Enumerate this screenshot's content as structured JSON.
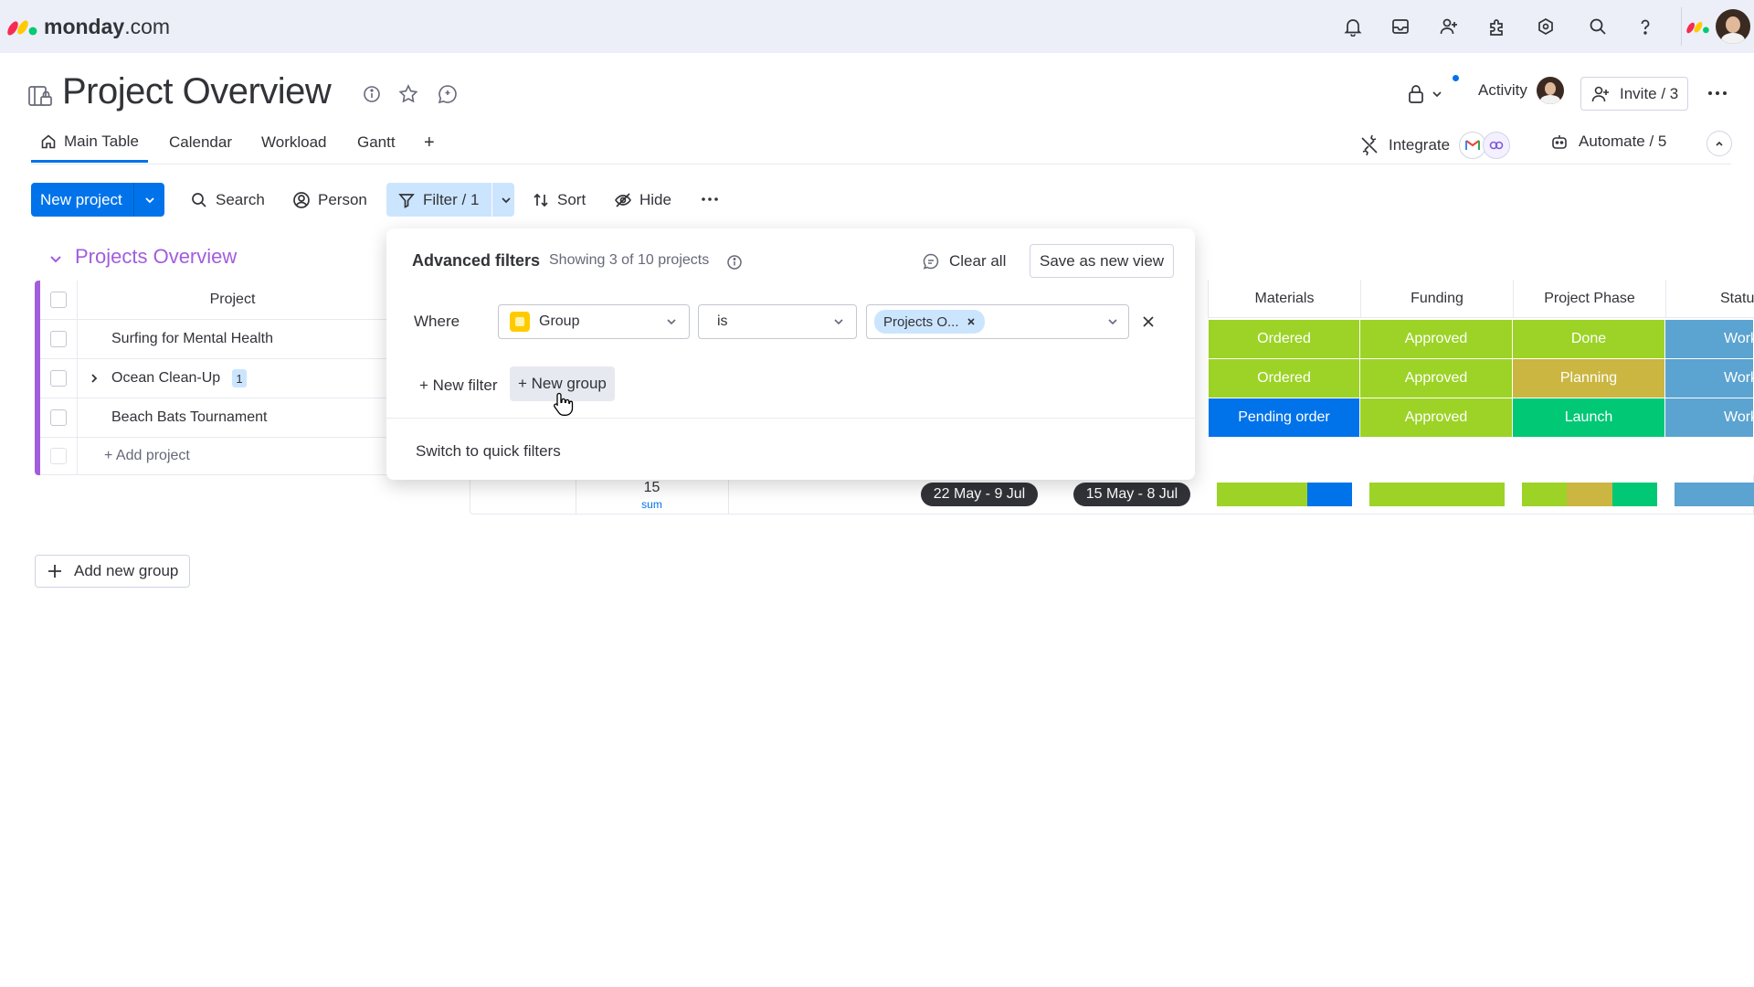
{
  "app": {
    "brand_bold": "monday",
    "brand_suffix": ".com"
  },
  "board": {
    "title": "Project Overview"
  },
  "header_right": {
    "activity_label": "Activity",
    "invite_label": "Invite / 3"
  },
  "tabs": [
    {
      "label": "Main Table",
      "active": true
    },
    {
      "label": "Calendar",
      "active": false
    },
    {
      "label": "Workload",
      "active": false
    },
    {
      "label": "Gantt",
      "active": false
    }
  ],
  "tabs_add": "+",
  "integrations": {
    "integrate_label": "Integrate",
    "automate_label": "Automate / 5"
  },
  "toolbar": {
    "new_project": "New project",
    "search": "Search",
    "person": "Person",
    "filter": "Filter / 1",
    "sort": "Sort",
    "hide": "Hide"
  },
  "group": {
    "name": "Projects Overview",
    "color": "#a25ddc",
    "column_project": "Project",
    "columns": [
      "Materials",
      "Funding",
      "Project Phase",
      "Statu"
    ],
    "rows": [
      {
        "name": "Surfing for Mental Health",
        "subitems": null,
        "materials": "Ordered",
        "funding": "Approved",
        "phase": "Done",
        "status": "Working"
      },
      {
        "name": "Ocean Clean-Up",
        "subitems": "1",
        "materials": "Ordered",
        "funding": "Approved",
        "phase": "Planning",
        "status": "Working"
      },
      {
        "name": "Beach Bats Tournament",
        "subitems": null,
        "materials": "Pending order",
        "funding": "Approved",
        "phase": "Launch",
        "status": "Working"
      }
    ],
    "add_item": "+ Add project",
    "summary": {
      "number": "15",
      "number_func": "sum",
      "timeline_1": "22 May - 9 Jul",
      "timeline_2": "15 May - 8 Jul"
    }
  },
  "add_group": "Add new group",
  "status_colors": {
    "green_light": "#9cd326",
    "blue_dark": "#0073ea",
    "green": "#00c875",
    "mustard": "#cab641",
    "blue_grey": "#579bfc",
    "working": "#5ba3d0",
    "brand_blue": "#0073ea"
  },
  "filter": {
    "title": "Advanced filters",
    "showing": "Showing 3 of 10 projects",
    "clear_all": "Clear all",
    "save_view": "Save as new view",
    "where": "Where",
    "column_select": "Group",
    "condition_select": "is",
    "value_chip": "Projects O...",
    "new_filter": "+ New filter",
    "new_group": "+ New group",
    "switch_quick": "Switch to quick filters"
  }
}
